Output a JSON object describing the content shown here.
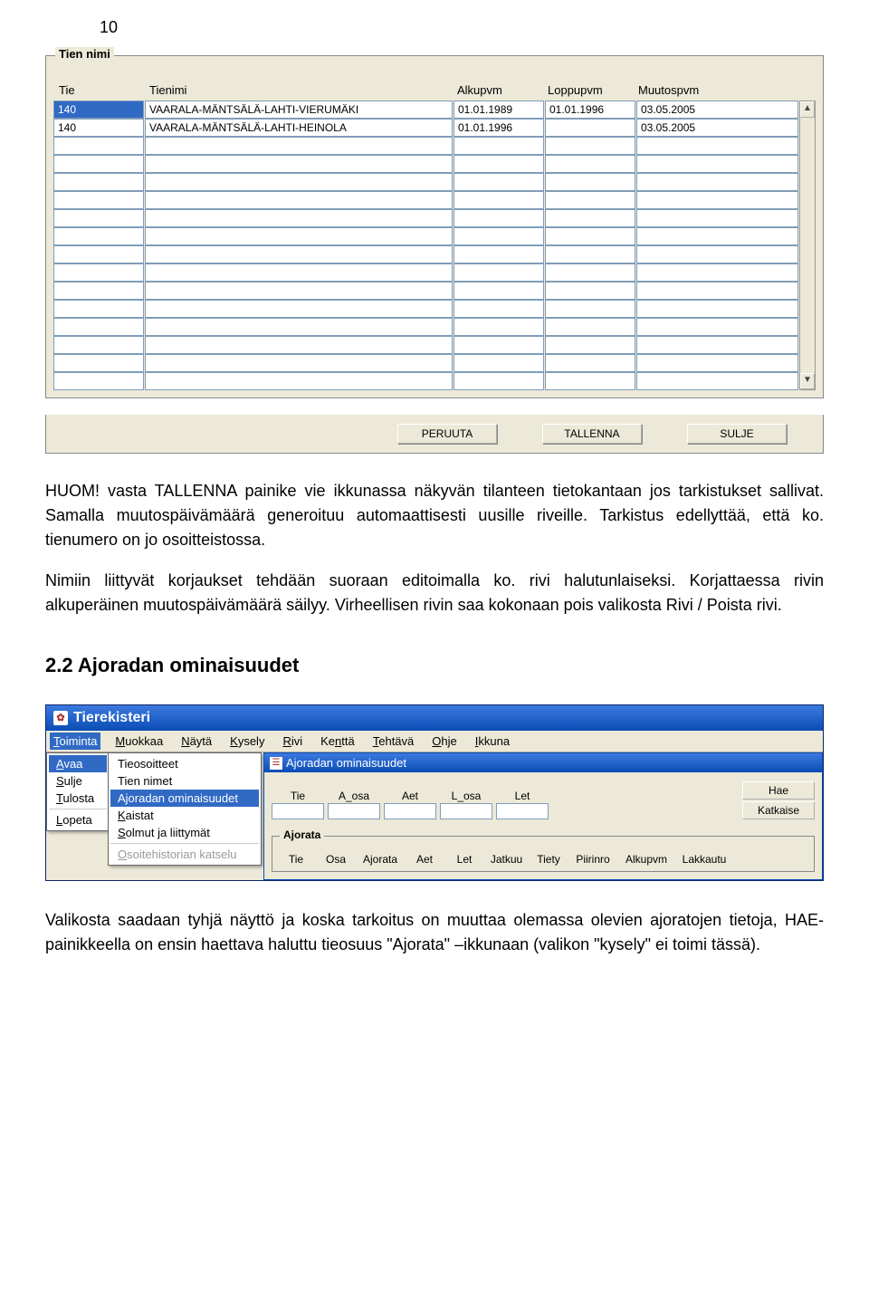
{
  "page_number": "10",
  "screenshot1": {
    "groupbox_label": "Tien nimi",
    "headers": {
      "tie": "Tie",
      "tienimi": "Tienimi",
      "alkupvm": "Alkupvm",
      "loppupvm": "Loppupvm",
      "muutospvm": "Muutospvm"
    },
    "rows": [
      {
        "tie": "140",
        "tienimi": "VAARALA-MÄNTSÄLÄ-LAHTI-VIERUMÄKI",
        "alkupvm": "01.01.1989",
        "loppupvm": "01.01.1996",
        "muutospvm": "03.05.2005",
        "selected": true
      },
      {
        "tie": "140",
        "tienimi": "VAARALA-MÄNTSÄLÄ-LAHTI-HEINOLA",
        "alkupvm": "01.01.1996",
        "loppupvm": "",
        "muutospvm": "03.05.2005",
        "selected": false
      }
    ],
    "empty_row_count": 14,
    "buttons": {
      "peruuta": "PERUUTA",
      "tallenna": "TALLENNA",
      "sulje": "SULJE"
    }
  },
  "para1": "HUOM! vasta TALLENNA painike vie ikkunassa näkyvän tilanteen tietokantaan jos tarkistukset sallivat. Samalla muutospäivämäärä generoituu automaattisesti uusille riveille. Tarkistus edellyttää, että ko. tienumero on jo osoitteistossa.",
  "para2": "Nimiin liittyvät korjaukset tehdään suoraan editoimalla ko. rivi halutunlaiseksi. Korjattaessa rivin alkuperäinen muutospäivämäärä säilyy. Virheellisen rivin saa kokonaan pois valikosta Rivi / Poista rivi.",
  "heading": "2.2 Ajoradan ominaisuudet",
  "screenshot2": {
    "app_title": "Tierekisteri",
    "menubar": [
      "Toiminta",
      "Muokkaa",
      "Näytä",
      "Kysely",
      "Rivi",
      "Kenttä",
      "Tehtävä",
      "Ohje",
      "Ikkuna"
    ],
    "menubar_underline": [
      "T",
      "M",
      "N",
      "K",
      "R",
      "n",
      "T",
      "O",
      "I"
    ],
    "dropdown": [
      "Avaa",
      "Sulje",
      "Tulosta",
      "Lopeta"
    ],
    "dropdown_underline": [
      "A",
      "S",
      "T",
      "L"
    ],
    "dropdown_selected": "Avaa",
    "submenu": [
      {
        "label": "Tieosoitteet",
        "u": "",
        "sel": false,
        "disabled": false
      },
      {
        "label": "Tien nimet",
        "u": "",
        "sel": false,
        "disabled": false
      },
      {
        "label": "Ajoradan ominaisuudet",
        "u": "",
        "sel": true,
        "disabled": false
      },
      {
        "label": "Kaistat",
        "u": "K",
        "sel": false,
        "disabled": false
      },
      {
        "label": "Solmut ja liittymät",
        "u": "S",
        "sel": false,
        "disabled": false
      },
      {
        "label": "Osoitehistorian katselu",
        "u": "O",
        "sel": false,
        "disabled": true
      }
    ],
    "subwindow_title": "Ajoradan ominaisuudet",
    "fields_top": [
      "Tie",
      "A_osa",
      "Aet",
      "L_osa",
      "Let"
    ],
    "side_buttons": {
      "hae": "Hae",
      "katkaise": "Katkaise"
    },
    "inner_group_label": "Ajorata",
    "inner_headers": [
      "Tie",
      "Osa",
      "Ajorata",
      "Aet",
      "Let",
      "Jatkuu",
      "Tiety",
      "Piirinro",
      "Alkupvm",
      "Lakkautu"
    ]
  },
  "para3": "Valikosta saadaan tyhjä näyttö ja koska tarkoitus on muuttaa olemassa olevien ajoratojen tietoja, HAE-painikkeella on ensin haettava haluttu tieosuus \"Ajorata\" –ikkunaan (valikon \"kysely\" ei toimi tässä)."
}
